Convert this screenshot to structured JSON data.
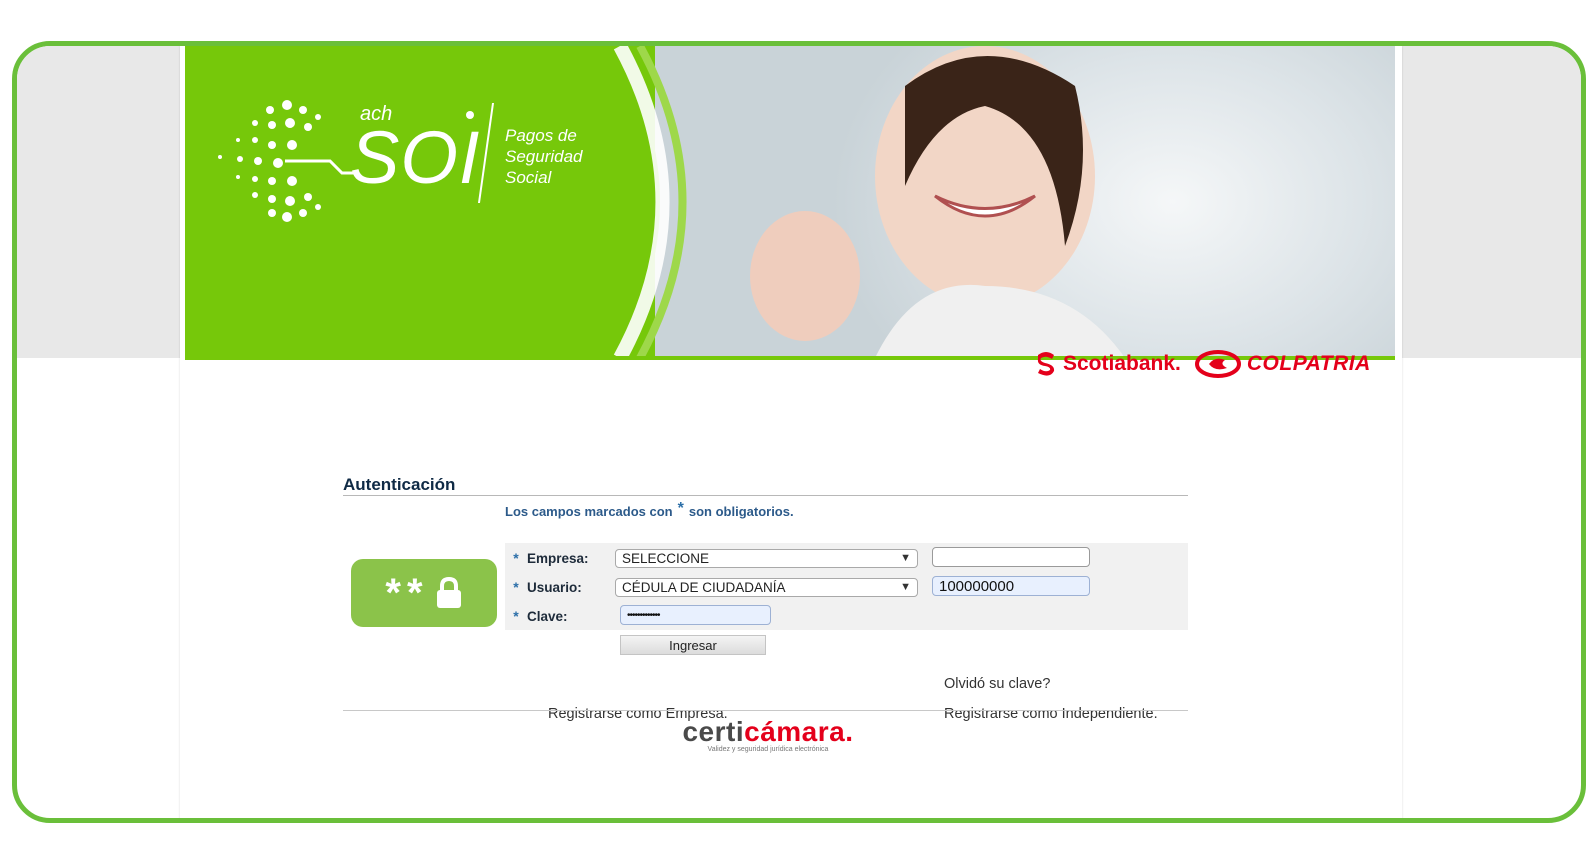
{
  "banner": {
    "logo_small": "ach",
    "logo_main": "SOI",
    "tagline_lines": [
      "Pagos de",
      "Seguridad",
      "Social"
    ]
  },
  "partners": {
    "scotiabank": "Scotiabank.",
    "colpatria": "COLPATRIA"
  },
  "auth": {
    "title": "Autenticación",
    "mandatory_prefix": "Los campos marcados con",
    "mandatory_asterisk": "*",
    "mandatory_suffix": "son obligatorios.",
    "lock_badge": "**",
    "fields": {
      "empresa_label": "Empresa:",
      "empresa_select": "SELECCIONE",
      "empresa_input": "",
      "usuario_label": "Usuario:",
      "usuario_select": "CÉDULA DE CIUDADANÍA",
      "usuario_input": "100000000",
      "clave_label": "Clave:",
      "clave_value": "•••••••••••••"
    },
    "required_marker": "*",
    "login_button": "Ingresar",
    "forgot_link": "Olvidó su clave?",
    "register_company": "Registrarse como Empresa.",
    "register_independent": "Registrarse como Independiente."
  },
  "footer": {
    "certicamara_prefix": "certi",
    "certicamara_suffix": "cámara.",
    "certicamara_tagline": "Validez y seguridad jurídica electrónica"
  },
  "colors": {
    "brand_green": "#76c80a",
    "frame_green": "#6abf3a",
    "partner_red": "#e4001b"
  }
}
